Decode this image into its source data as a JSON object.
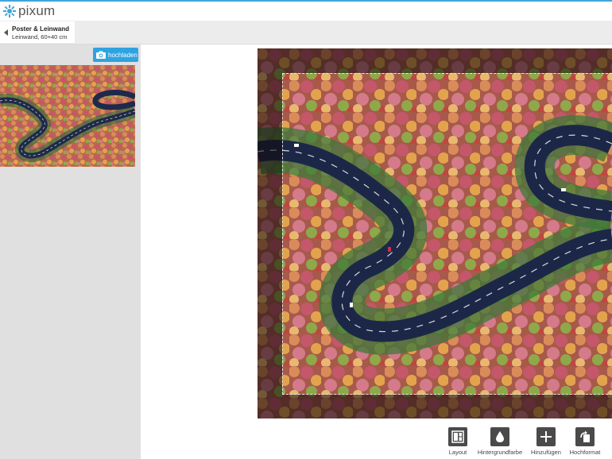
{
  "header": {
    "logo_text": "pixum",
    "accent_color": "#3fa6d8"
  },
  "product": {
    "title": "Poster & Leinwand",
    "subtitle": "Leinwand, 60×40 cm"
  },
  "sidebar": {
    "upload_label": "hochladen",
    "upload_icon": "camera-icon",
    "upload_color": "#2ea3e0"
  },
  "toolbar": {
    "items": [
      {
        "label": "Layout",
        "icon": "layout-icon"
      },
      {
        "label": "Hintergrundfarbe",
        "icon": "drop-icon"
      },
      {
        "label": "Hinzufügen",
        "icon": "plus-icon"
      },
      {
        "label": "Hochformat",
        "icon": "rotate-icon"
      }
    ]
  }
}
